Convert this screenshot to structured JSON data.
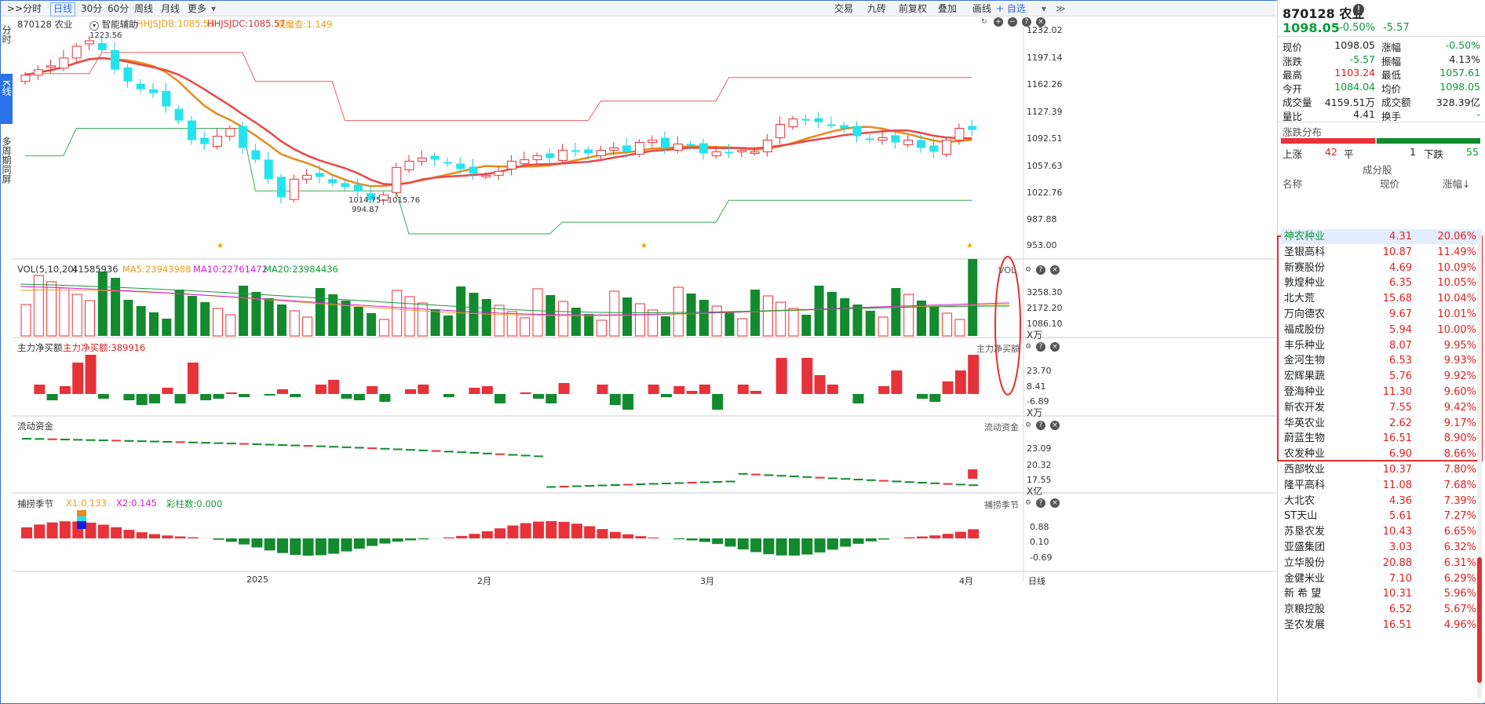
{
  "toolbar": {
    "left": [
      ">>",
      "分时",
      "日线",
      "30分",
      "60分",
      "周线",
      "月线",
      "更多"
    ],
    "right": [
      "交易",
      "九砖",
      "前复权",
      "叠加",
      "画线",
      "+ 自选"
    ],
    "active": "日线"
  },
  "left_tabs": [
    "分时",
    "K线",
    "多周期同屏"
  ],
  "chart": {
    "title": "870128 农业",
    "assist": "智能辅助",
    "hhjsjdb": "HHJSJDB:1085.53",
    "hhjsjdc": "HHJSJDC:1085.57",
    "other": "晓魔查:1.149",
    "price_axis": [
      "1232.02",
      "1197.14",
      "1162.26",
      "1127.39",
      "1092.51",
      "1057.63",
      "1022.76",
      "987.88",
      "953.00"
    ],
    "annotations": [
      "1223.56",
      "1014.75~1015.76",
      "994.87"
    ],
    "vol_legend": {
      "name": "VOL(5,10,20)",
      "vol": "41585936",
      "ma5": "MA5:23943988",
      "ma10": "MA10:22761472",
      "ma20": "MA20:23984436"
    },
    "vol_axis": [
      "3258.30",
      "2172.20",
      "1086.10",
      "X万"
    ],
    "vol_tag": "VOL",
    "flow_legend": {
      "name": "主力净买额",
      "value": "主力净买额:389916"
    },
    "flow_axis": [
      "23.70",
      "8.41",
      "-6.89",
      "X万"
    ],
    "flow_tag": "主力净买额",
    "liq_legend": "流动资金",
    "liq_axis": [
      "23.09",
      "20.32",
      "17.55",
      "X亿"
    ],
    "liq_tag": "流动资金",
    "season_legend": {
      "name": "捕捞季节",
      "x1": "X1:0.133",
      "x2": "X2:0.145",
      "bars": "彩柱数:0.000"
    },
    "season_axis": [
      "0.88",
      "0.10",
      "-0.69"
    ],
    "season_tag": "捕捞季节",
    "date_axis": [
      "2025",
      "2月",
      "3月",
      "4月"
    ],
    "period_tag": "日线"
  },
  "chart_data": {
    "type": "candlestick",
    "title": "870128 农业",
    "ylim": [
      953.0,
      1232.02
    ],
    "x_ticks": [
      "2025",
      "2月",
      "3月",
      "4月"
    ],
    "close_approx": [
      1168,
      1175,
      1180,
      1190,
      1205,
      1212,
      1200,
      1175,
      1160,
      1150,
      1145,
      1128,
      1110,
      1085,
      1080,
      1090,
      1100,
      1075,
      1060,
      1035,
      1012,
      1035,
      1040,
      1038,
      1030,
      1025,
      1020,
      1008,
      1015,
      1050,
      1058,
      1062,
      1060,
      1055,
      1048,
      1042,
      1040,
      1045,
      1058,
      1060,
      1065,
      1062,
      1072,
      1070,
      1068,
      1072,
      1075,
      1070,
      1082,
      1085,
      1075,
      1080,
      1078,
      1068,
      1070,
      1068,
      1072,
      1070,
      1085,
      1105,
      1112,
      1110,
      1108,
      1104,
      1100,
      1090,
      1085,
      1088,
      1082,
      1085,
      1075,
      1070,
      1085,
      1100,
      1098
    ],
    "series": [
      {
        "name": "HHJSJDB",
        "last": 1085.53
      },
      {
        "name": "HHJSJDC",
        "last": 1085.57
      }
    ]
  },
  "panel": {
    "code_name": "870128 农业",
    "price": "1098.05",
    "chg_pct": "-0.50%",
    "chg": "-5.57",
    "quote": [
      [
        "现价",
        "1098.05",
        "涨幅",
        "-0.50%"
      ],
      [
        "涨跌",
        "-5.57",
        "振幅",
        "4.13%"
      ],
      [
        "最高",
        "1103.24",
        "最低",
        "1057.61"
      ],
      [
        "今开",
        "1084.04",
        "均价",
        "1098.05"
      ],
      [
        "成交量",
        "4159.51万",
        "成交额",
        "328.39亿"
      ],
      [
        "量比",
        "4.41",
        "换手",
        "-"
      ]
    ],
    "dist_title": "涨跌分布",
    "up_label": "上涨",
    "up": "42",
    "flat_label": "平",
    "flat": "1",
    "down_label": "下跌",
    "down": "55",
    "const_title": "成分股",
    "cols": [
      "名称",
      "现价",
      "涨幅↓"
    ],
    "stocks": [
      [
        "神农种业",
        "4.31",
        "20.06%"
      ],
      [
        "圣银高科",
        "10.87",
        "11.49%"
      ],
      [
        "新赛股份",
        "4.69",
        "10.09%"
      ],
      [
        "敦煌种业",
        "6.35",
        "10.05%"
      ],
      [
        "北大荒",
        "15.68",
        "10.04%"
      ],
      [
        "万向德农",
        "9.67",
        "10.01%"
      ],
      [
        "福成股份",
        "5.94",
        "10.00%"
      ],
      [
        "丰乐种业",
        "8.07",
        "9.95%"
      ],
      [
        "金河生物",
        "6.53",
        "9.93%"
      ],
      [
        "宏辉果蔬",
        "5.76",
        "9.92%"
      ],
      [
        "登海种业",
        "11.30",
        "9.60%"
      ],
      [
        "新农开发",
        "7.55",
        "9.42%"
      ],
      [
        "华英农业",
        "2.62",
        "9.17%"
      ],
      [
        "蔚蓝生物",
        "16.51",
        "8.90%"
      ],
      [
        "农发种业",
        "6.90",
        "8.66%"
      ],
      [
        "西部牧业",
        "10.37",
        "7.80%"
      ],
      [
        "隆平高科",
        "11.08",
        "7.68%"
      ],
      [
        "大北农",
        "4.36",
        "7.39%"
      ],
      [
        "ST天山",
        "5.61",
        "7.27%"
      ],
      [
        "苏垦农发",
        "10.43",
        "6.65%"
      ],
      [
        "亚盛集团",
        "3.03",
        "6.32%"
      ],
      [
        "立华股份",
        "20.88",
        "6.31%"
      ],
      [
        "金健米业",
        "7.10",
        "6.29%"
      ],
      [
        "新 希 望",
        "10.31",
        "5.96%"
      ],
      [
        "京粮控股",
        "6.52",
        "5.67%"
      ],
      [
        "圣农发展",
        "16.51",
        "4.96%"
      ]
    ]
  },
  "colors": {
    "up": "#e8323a",
    "down": "#138a2e",
    "cyan": "#25e3ee",
    "ma_orange": "#e88a1a",
    "ma_red": "#e84848",
    "accent": "#1e6fff"
  }
}
